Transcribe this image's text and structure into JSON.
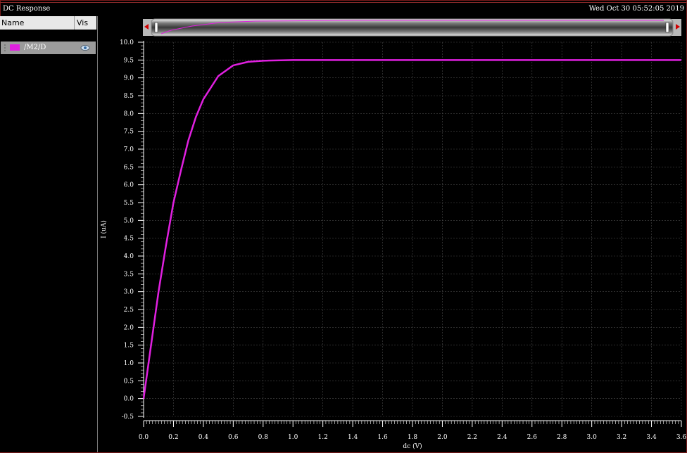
{
  "window": {
    "title": "DC Response",
    "timestamp": "Wed Oct 30 05:52:05 2019"
  },
  "sidebar": {
    "col_name": "Name",
    "col_vis": "Vis",
    "traces": [
      {
        "label": "/M2/D",
        "color": "#e020e0"
      }
    ]
  },
  "colors": {
    "background": "#000000",
    "trace": "#e020e0",
    "grid": "#4a4a4a"
  },
  "chart_data": {
    "type": "line",
    "xlabel": "dc (V)",
    "ylabel": "I (uA)",
    "xlim": [
      0.0,
      3.6
    ],
    "ylim": [
      -0.5,
      10.0
    ],
    "x_ticks": [
      "0.0",
      "0.2",
      "0.4",
      "0.6",
      "0.8",
      "1.0",
      "1.2",
      "1.4",
      "1.6",
      "1.8",
      "2.0",
      "2.2",
      "2.4",
      "2.6",
      "2.8",
      "3.0",
      "3.2",
      "3.4",
      "3.6"
    ],
    "y_ticks": [
      "-0.5",
      "0.0",
      "0.5",
      "1.0",
      "1.5",
      "2.0",
      "2.5",
      "3.0",
      "3.5",
      "4.0",
      "4.5",
      "5.0",
      "5.5",
      "6.0",
      "6.5",
      "7.0",
      "7.5",
      "8.0",
      "8.5",
      "9.0",
      "9.5",
      "10.0"
    ],
    "grid": true,
    "series": [
      {
        "name": "/M2/D",
        "color": "#e020e0",
        "x": [
          0.0,
          0.05,
          0.1,
          0.15,
          0.2,
          0.25,
          0.3,
          0.35,
          0.4,
          0.5,
          0.6,
          0.7,
          0.8,
          1.0,
          1.5,
          2.0,
          2.5,
          3.0,
          3.6
        ],
        "y": [
          0.0,
          1.5,
          3.0,
          4.3,
          5.5,
          6.4,
          7.25,
          7.9,
          8.4,
          9.05,
          9.35,
          9.45,
          9.48,
          9.5,
          9.5,
          9.5,
          9.5,
          9.5,
          9.5
        ]
      }
    ]
  }
}
